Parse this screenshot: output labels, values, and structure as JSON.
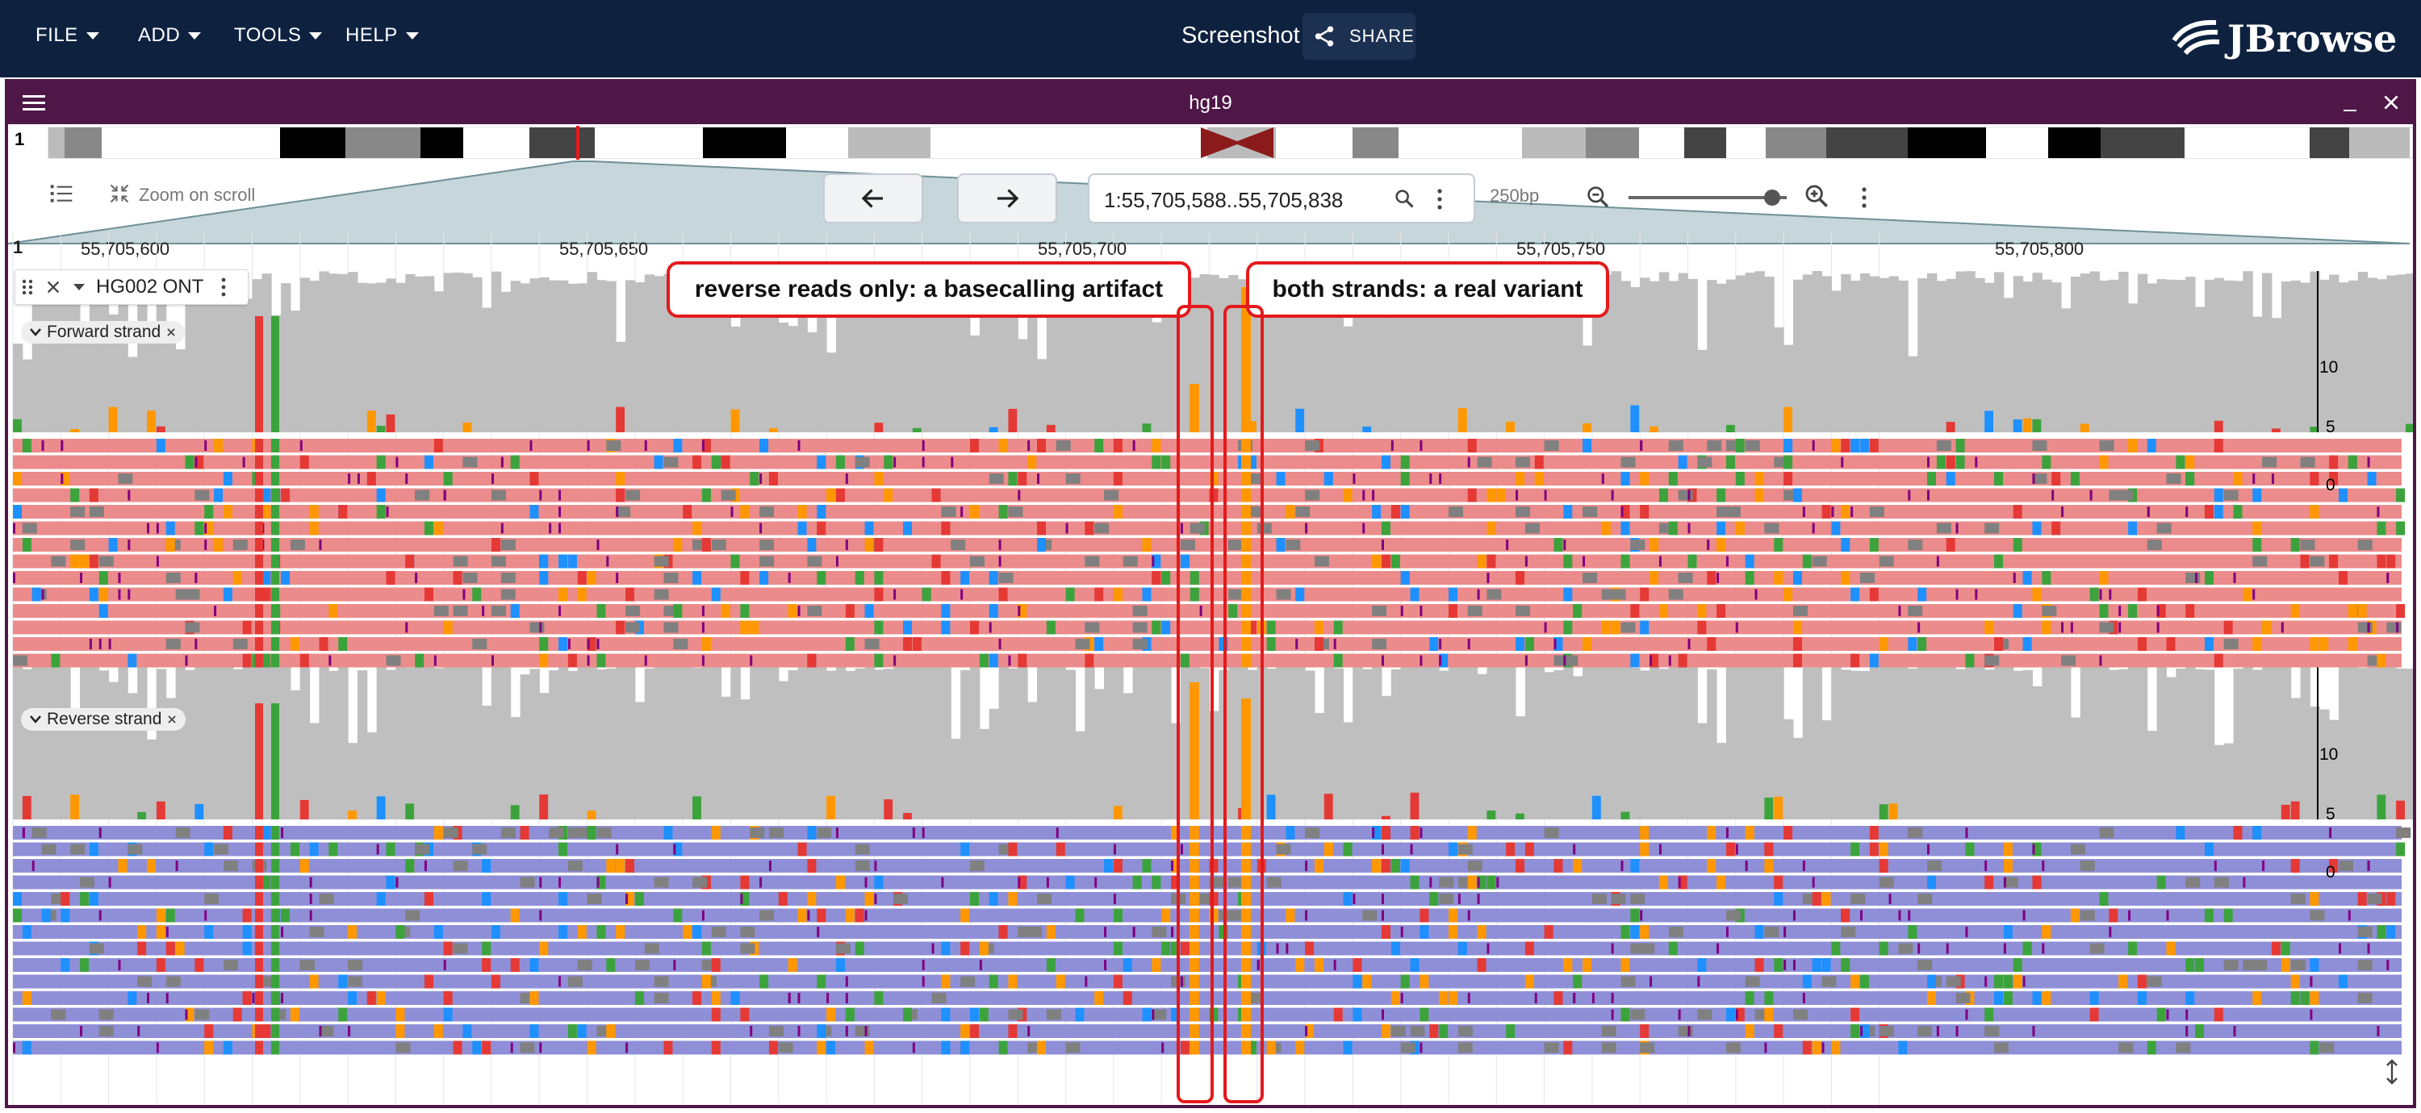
{
  "app": {
    "menu": [
      "FILE",
      "ADD",
      "TOOLS",
      "HELP"
    ],
    "session_name": "Screenshot",
    "share_label": "SHARE",
    "logo_text": "JBrowse"
  },
  "view": {
    "title": "hg19",
    "chrom_label": "1",
    "zoom_on_scroll": "Zoom on scroll",
    "locstring": "1:55,705,588..55,705,838",
    "bp_label": "250bp"
  },
  "ruler": {
    "chrom": "1",
    "ticks": [
      "55,705,600",
      "55,705,650",
      "55,705,700",
      "55,705,750",
      "55,705,800"
    ]
  },
  "track": {
    "name": "HG002 ONT",
    "forward_label": "Forward strand",
    "reverse_label": "Reverse strand",
    "coverage_ticks": [
      "10",
      "5",
      "0"
    ]
  },
  "annotations": {
    "left": "reverse reads only: a basecalling artifact",
    "right": "both strands: a real variant"
  },
  "colors": {
    "topbar": "#0e2240",
    "view_header": "#4f1748",
    "forward_read": "#ec8b8b",
    "reverse_read": "#8f8fd8",
    "coverage": "#bfbfbf",
    "base_A": "#3ca33c",
    "base_C": "#1e90ff",
    "base_G": "#ff9800",
    "base_T": "#e53935",
    "insertion": "#800080",
    "highlight": "#e41a1c"
  }
}
